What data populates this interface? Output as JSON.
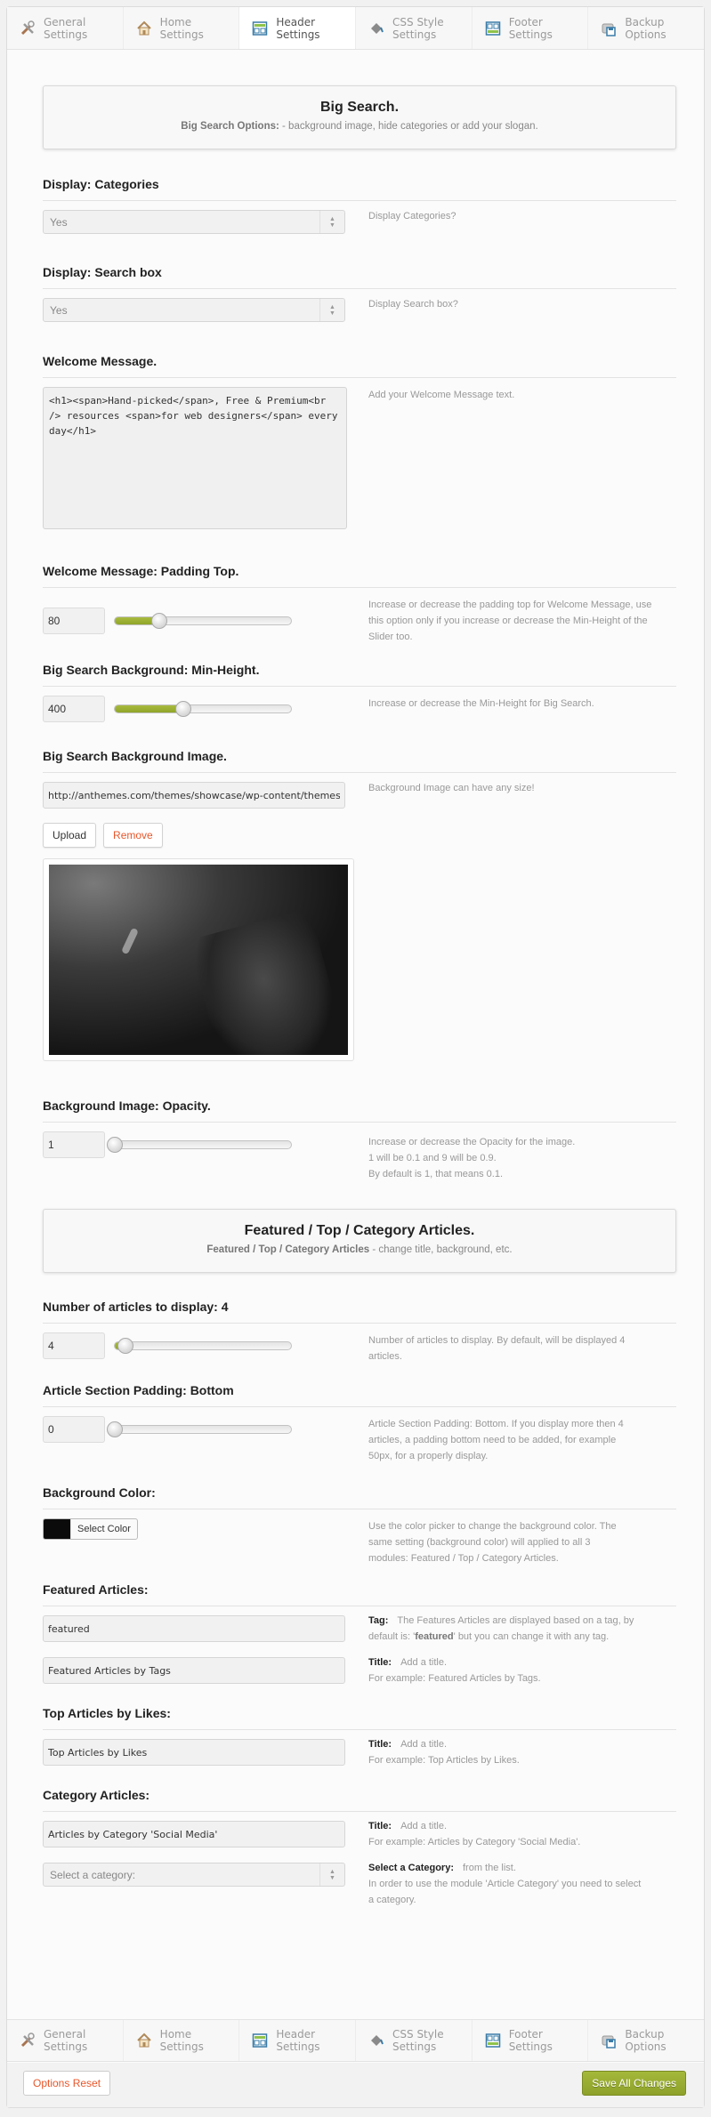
{
  "tabs": [
    {
      "label": "General\nSettings",
      "icon": "tools-icon"
    },
    {
      "label": "Home\nSettings",
      "icon": "home-icon"
    },
    {
      "label": "Header\nSettings",
      "icon": "header-layout-icon",
      "active": true
    },
    {
      "label": "CSS Style\nSettings",
      "icon": "paint-bucket-icon"
    },
    {
      "label": "Footer\nSettings",
      "icon": "footer-layout-icon"
    },
    {
      "label": "Backup\nOptions",
      "icon": "floppy-disk-icon"
    }
  ],
  "big_search": {
    "title": "Big Search.",
    "subtitle_bold": "Big Search Options:",
    "subtitle_rest": " - background image, hide categories or add your slogan."
  },
  "display_categories": {
    "heading": "Display: Categories",
    "value": "Yes",
    "desc": "Display Categories?"
  },
  "display_search": {
    "heading": "Display: Search box",
    "value": "Yes",
    "desc": "Display Search box?"
  },
  "welcome": {
    "heading": "Welcome Message.",
    "value": "<h1><span>Hand-picked</span>, Free & Premium<br /> resources <span>for web designers</span> every day</h1>",
    "desc": "Add your Welcome Message text."
  },
  "padding_top": {
    "heading": "Welcome Message: Padding Top.",
    "value": "80",
    "fraction": 0.25,
    "desc": "Increase or decrease the padding top for Welcome Message, use this option only if you increase or decrease the Min-Height of the Slider too."
  },
  "min_height": {
    "heading": "Big Search Background: Min-Height.",
    "value": "400",
    "fraction": 0.39,
    "desc": "Increase or decrease the Min-Height for Big Search."
  },
  "bg_image": {
    "heading": "Big Search Background Image.",
    "value": "http://anthemes.com/themes/showcase/wp-content/themes/",
    "desc": "Background Image can have any size!",
    "upload_label": "Upload",
    "remove_label": "Remove"
  },
  "opacity": {
    "heading": "Background Image: Opacity.",
    "value": "1",
    "fraction": 0.0,
    "desc_lines": [
      "Increase or decrease the Opacity for the image.",
      "1 will be 0.1 and 9 will be 0.9.",
      "By default is 1, that means 0.1."
    ]
  },
  "articles": {
    "title": "Featured / Top / Category Articles.",
    "subtitle_bold": "Featured / Top / Category Articles",
    "subtitle_rest": " - change title, background, etc."
  },
  "num_articles": {
    "heading": "Number of articles to display: 4",
    "value": "4",
    "fraction": 0.06,
    "desc": "Number of articles to display. By default, will be displayed 4 articles."
  },
  "padding_bottom": {
    "heading": "Article Section Padding: Bottom",
    "value": "0",
    "fraction": 0.0,
    "desc": "Article Section Padding: Bottom. If you display more then 4 articles, a padding bottom need to be added, for example 50px, for a properly display."
  },
  "bg_color": {
    "heading": "Background Color:",
    "color": "#0b0b0b",
    "button_label": "Select Color",
    "desc": "Use the color picker to change the background color. The same setting (background color) will applied to all 3 modules: Featured / Top / Category Articles."
  },
  "featured": {
    "heading": "Featured Articles:",
    "tag_value": "featured",
    "tag_label": "Tag:",
    "tag_desc_pre": "The Features Articles are displayed based on a tag, by default is: '",
    "tag_desc_bold": "featured",
    "tag_desc_post": "' but you can change it with any tag.",
    "title_value": "Featured Articles by Tags",
    "title_label": "Title:",
    "title_desc": "Add a title.",
    "title_example": "For example: Featured Articles by Tags."
  },
  "top": {
    "heading": "Top Articles by Likes:",
    "title_value": "Top Articles by Likes",
    "title_label": "Title:",
    "title_desc": "Add a title.",
    "title_example": "For example: Top Articles by Likes."
  },
  "category": {
    "heading": "Category Articles:",
    "title_value": "Articles by Category 'Social Media'",
    "title_label": "Title:",
    "title_desc": "Add a title.",
    "title_example": "For example: Articles by Category 'Social Media'.",
    "select_value": "Select a category:",
    "select_label": "Select a Category:",
    "select_desc": "from the list.",
    "select_note": "In order to use the module 'Article Category' you need to select a category."
  },
  "footer": {
    "reset_label": "Options Reset",
    "save_label": "Save All Changes"
  },
  "colors": {
    "accent_green": "#9aae33",
    "remove_red": "#e8562a"
  }
}
